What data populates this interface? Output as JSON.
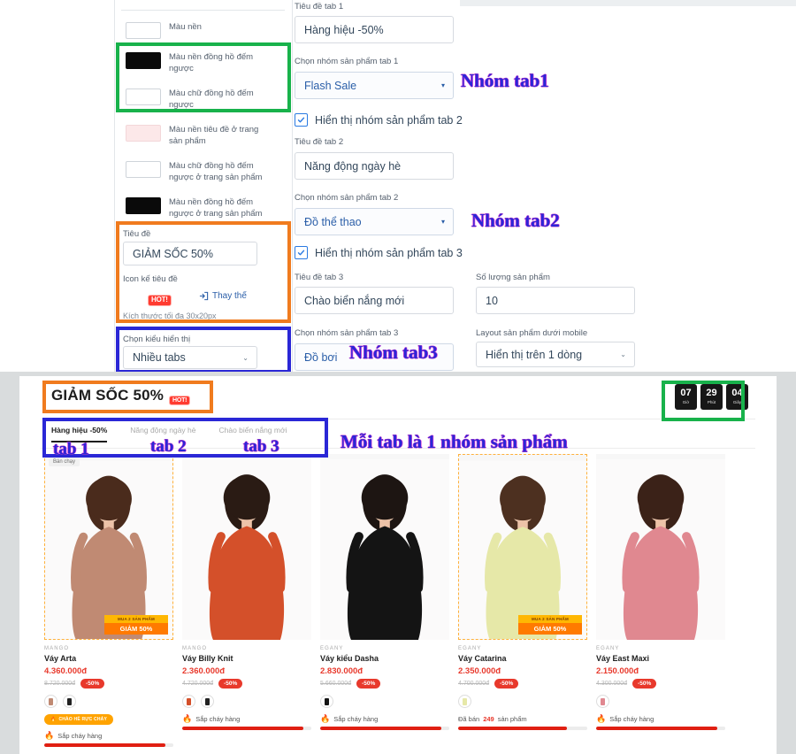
{
  "settings": {
    "color_options": [
      {
        "label": "Màu nền",
        "swatch": "#ffffff"
      },
      {
        "label": "Màu nền đồng hồ đếm ngược",
        "swatch": "#0a0a0a"
      },
      {
        "label": "Màu chữ đồng hồ đếm ngược",
        "swatch": "#ffffff"
      },
      {
        "label": "Màu nền tiêu đề ở trang sản phẩm",
        "swatch": "#fce8e9"
      },
      {
        "label": "Màu chữ đồng hồ đếm ngược ở trang sản phẩm",
        "swatch": "#ffffff"
      },
      {
        "label": "Màu nền đồng hồ đếm ngược ở trang sản phẩm",
        "swatch": "#0a0a0a"
      }
    ],
    "title_label": "Tiêu đề",
    "title_value": "GIẢM SỐC 50%",
    "icon_label": "Icon kế tiêu đề",
    "icon_badge": "HOT!",
    "replace_label": "Thay thế",
    "size_hint": "Kích thước tối đa 30x20px",
    "display_mode_label": "Chọn kiểu hiển thị",
    "display_mode_value": "Nhiều tabs",
    "tab1_title_label": "Tiêu đề tab 1",
    "tab1_title_value": "Hàng hiệu -50%",
    "tab1_group_label": "Chọn nhóm sản phẩm tab 1",
    "tab1_group_value": "Flash Sale",
    "show_tab2_label": "Hiển thị nhóm sản phẩm tab 2",
    "tab2_title_label": "Tiêu đề tab 2",
    "tab2_title_value": "Năng động ngày hè",
    "tab2_group_label": "Chọn nhóm sản phẩm tab 2",
    "tab2_group_value": "Đồ thể thao",
    "show_tab3_label": "Hiển thị nhóm sản phẩm tab 3",
    "tab3_title_label": "Tiêu đề tab 3",
    "tab3_title_value": "Chào biển nắng mới",
    "tab3_group_label": "Chọn nhóm sản phẩm tab 3",
    "tab3_group_value": "Đồ bơi",
    "quantity_label": "Số lượng sản phẩm",
    "quantity_value": "10",
    "mobile_layout_label": "Layout sản phẩm dưới mobile",
    "mobile_layout_value": "Hiển thị trên 1 dòng"
  },
  "annotations": [
    {
      "text": "Nhóm tab1"
    },
    {
      "text": "Nhóm tab2"
    },
    {
      "text": "Nhóm tab3"
    },
    {
      "text": "Mỗi tab là 1 nhóm sản phẩm"
    },
    {
      "text": "tab 1"
    },
    {
      "text": "tab 2"
    },
    {
      "text": "tab 3"
    }
  ],
  "highlight_colors": {
    "green": "#18b24b",
    "orange": "#f07b1e",
    "blue": "#2a27d6"
  },
  "preview": {
    "title": "GIẢM SỐC 50%",
    "hot_badge": "HOT!",
    "countdown": [
      {
        "value": "07",
        "label": "Giờ"
      },
      {
        "value": "29",
        "label": "Phút"
      },
      {
        "value": "04",
        "label": "Giây"
      }
    ],
    "tabs": [
      {
        "label": "Hàng hiệu -50%",
        "active": true
      },
      {
        "label": "Năng động ngày hè",
        "active": false
      },
      {
        "label": "Chào biển nắng mới",
        "active": false
      }
    ],
    "products": [
      {
        "brand": "MANGO",
        "name": "Váy Arta",
        "price": "4.360.000đ",
        "old_price": "8.720.000đ",
        "discount": "-50%",
        "bestseller_badge": "Bán chạy",
        "promo_top": "MUA 2 SẢN PHẨM",
        "promo_bottom": "GIẢM 50%",
        "tag": "CHÀO HÈ RỰC CHÁY",
        "status": "Sắp cháy hàng",
        "progress": 94,
        "dots": 2,
        "dashed": true
      },
      {
        "brand": "MANGO",
        "name": "Váy Billy Knit",
        "price": "2.360.000đ",
        "old_price": "4.720.000đ",
        "discount": "-50%",
        "status": "Sắp cháy hàng",
        "progress": 94,
        "dots": 2,
        "dashed": false
      },
      {
        "brand": "EGANY",
        "name": "Váy kiểu Dasha",
        "price": "2.830.000đ",
        "old_price": "5.660.000đ",
        "discount": "-50%",
        "status": "Sắp cháy hàng",
        "progress": 94,
        "dots": 1,
        "dashed": false
      },
      {
        "brand": "EGANY",
        "name": "Váy Catarina",
        "price": "2.350.000đ",
        "old_price": "4.700.000đ",
        "discount": "-50%",
        "promo_top": "MUA 2 SẢN PHẨM",
        "promo_bottom": "GIẢM 50%",
        "status_prefix": "Đã bán",
        "status_count": "249",
        "status_suffix": "sản phẩm",
        "progress": 84,
        "dots": 1,
        "dashed": true
      },
      {
        "brand": "EGANY",
        "name": "Váy East Maxi",
        "price": "2.150.000đ",
        "old_price": "4.300.000đ",
        "discount": "-50%",
        "status": "Sắp cháy hàng",
        "progress": 94,
        "dots": 1,
        "dashed": false
      }
    ]
  }
}
